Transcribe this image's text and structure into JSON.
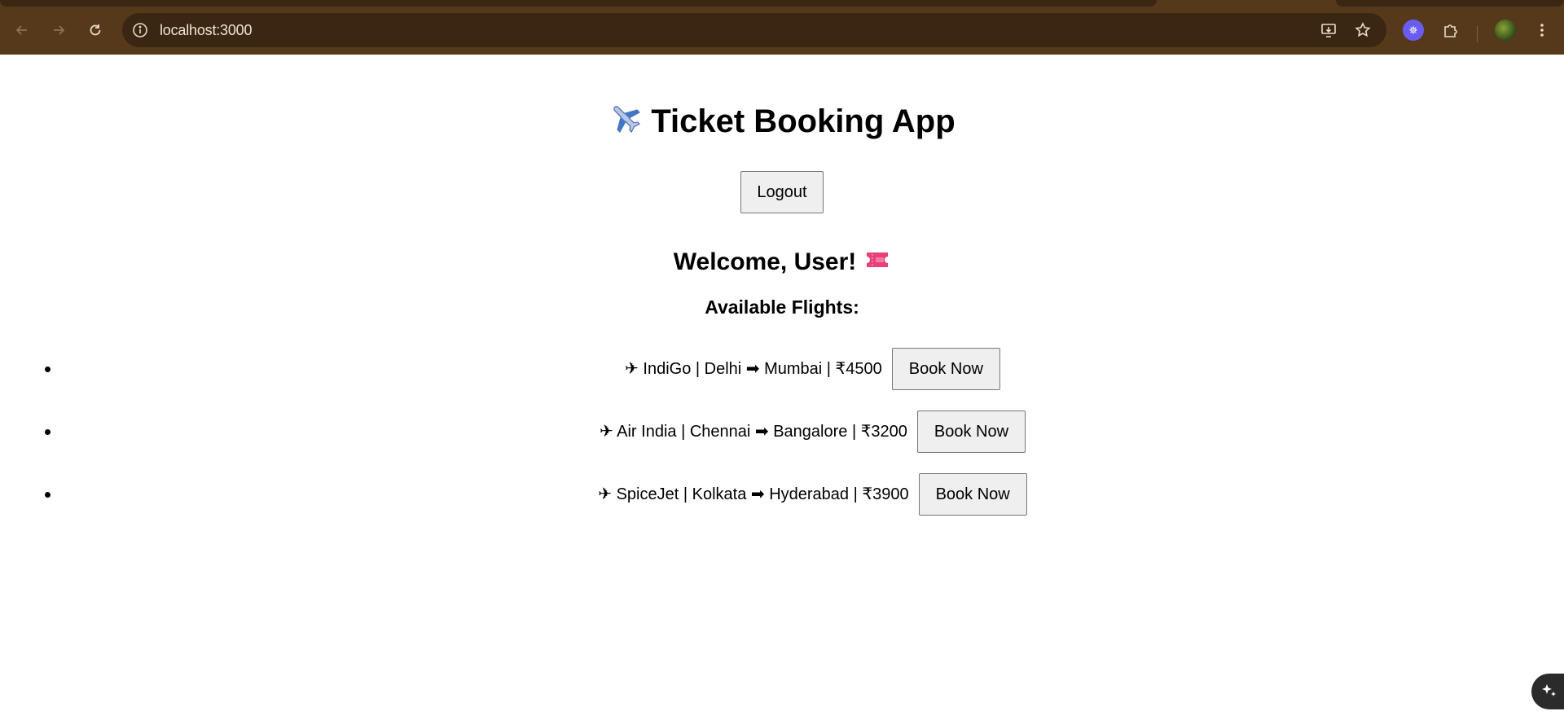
{
  "browser": {
    "url": "localhost:3000",
    "icons": {
      "back": "arrow-left-icon",
      "forward": "arrow-right-icon",
      "reload": "reload-icon",
      "site_info": "info-icon",
      "install": "install-app-icon",
      "bookmark": "star-icon",
      "extension": "extension-gear-icon",
      "extensions_menu": "puzzle-icon",
      "menu": "kebab-menu-icon"
    },
    "colors": {
      "frame": "#55391a",
      "omnibox": "#3a2611"
    }
  },
  "app": {
    "title": "Ticket Booking App",
    "title_icon": "airplane-icon",
    "logout_label": "Logout",
    "welcome": "Welcome, User!",
    "welcome_icon": "ticket-icon",
    "flights_heading": "Available Flights:",
    "flights": [
      {
        "text": "✈ IndiGo | Delhi ➡ Mumbai | ₹4500",
        "button": "Book Now"
      },
      {
        "text": "✈ Air India | Chennai ➡ Bangalore | ₹3200",
        "button": "Book Now"
      },
      {
        "text": "✈ SpiceJet | Kolkata ➡ Hyderabad | ₹3900",
        "button": "Book Now"
      }
    ]
  }
}
